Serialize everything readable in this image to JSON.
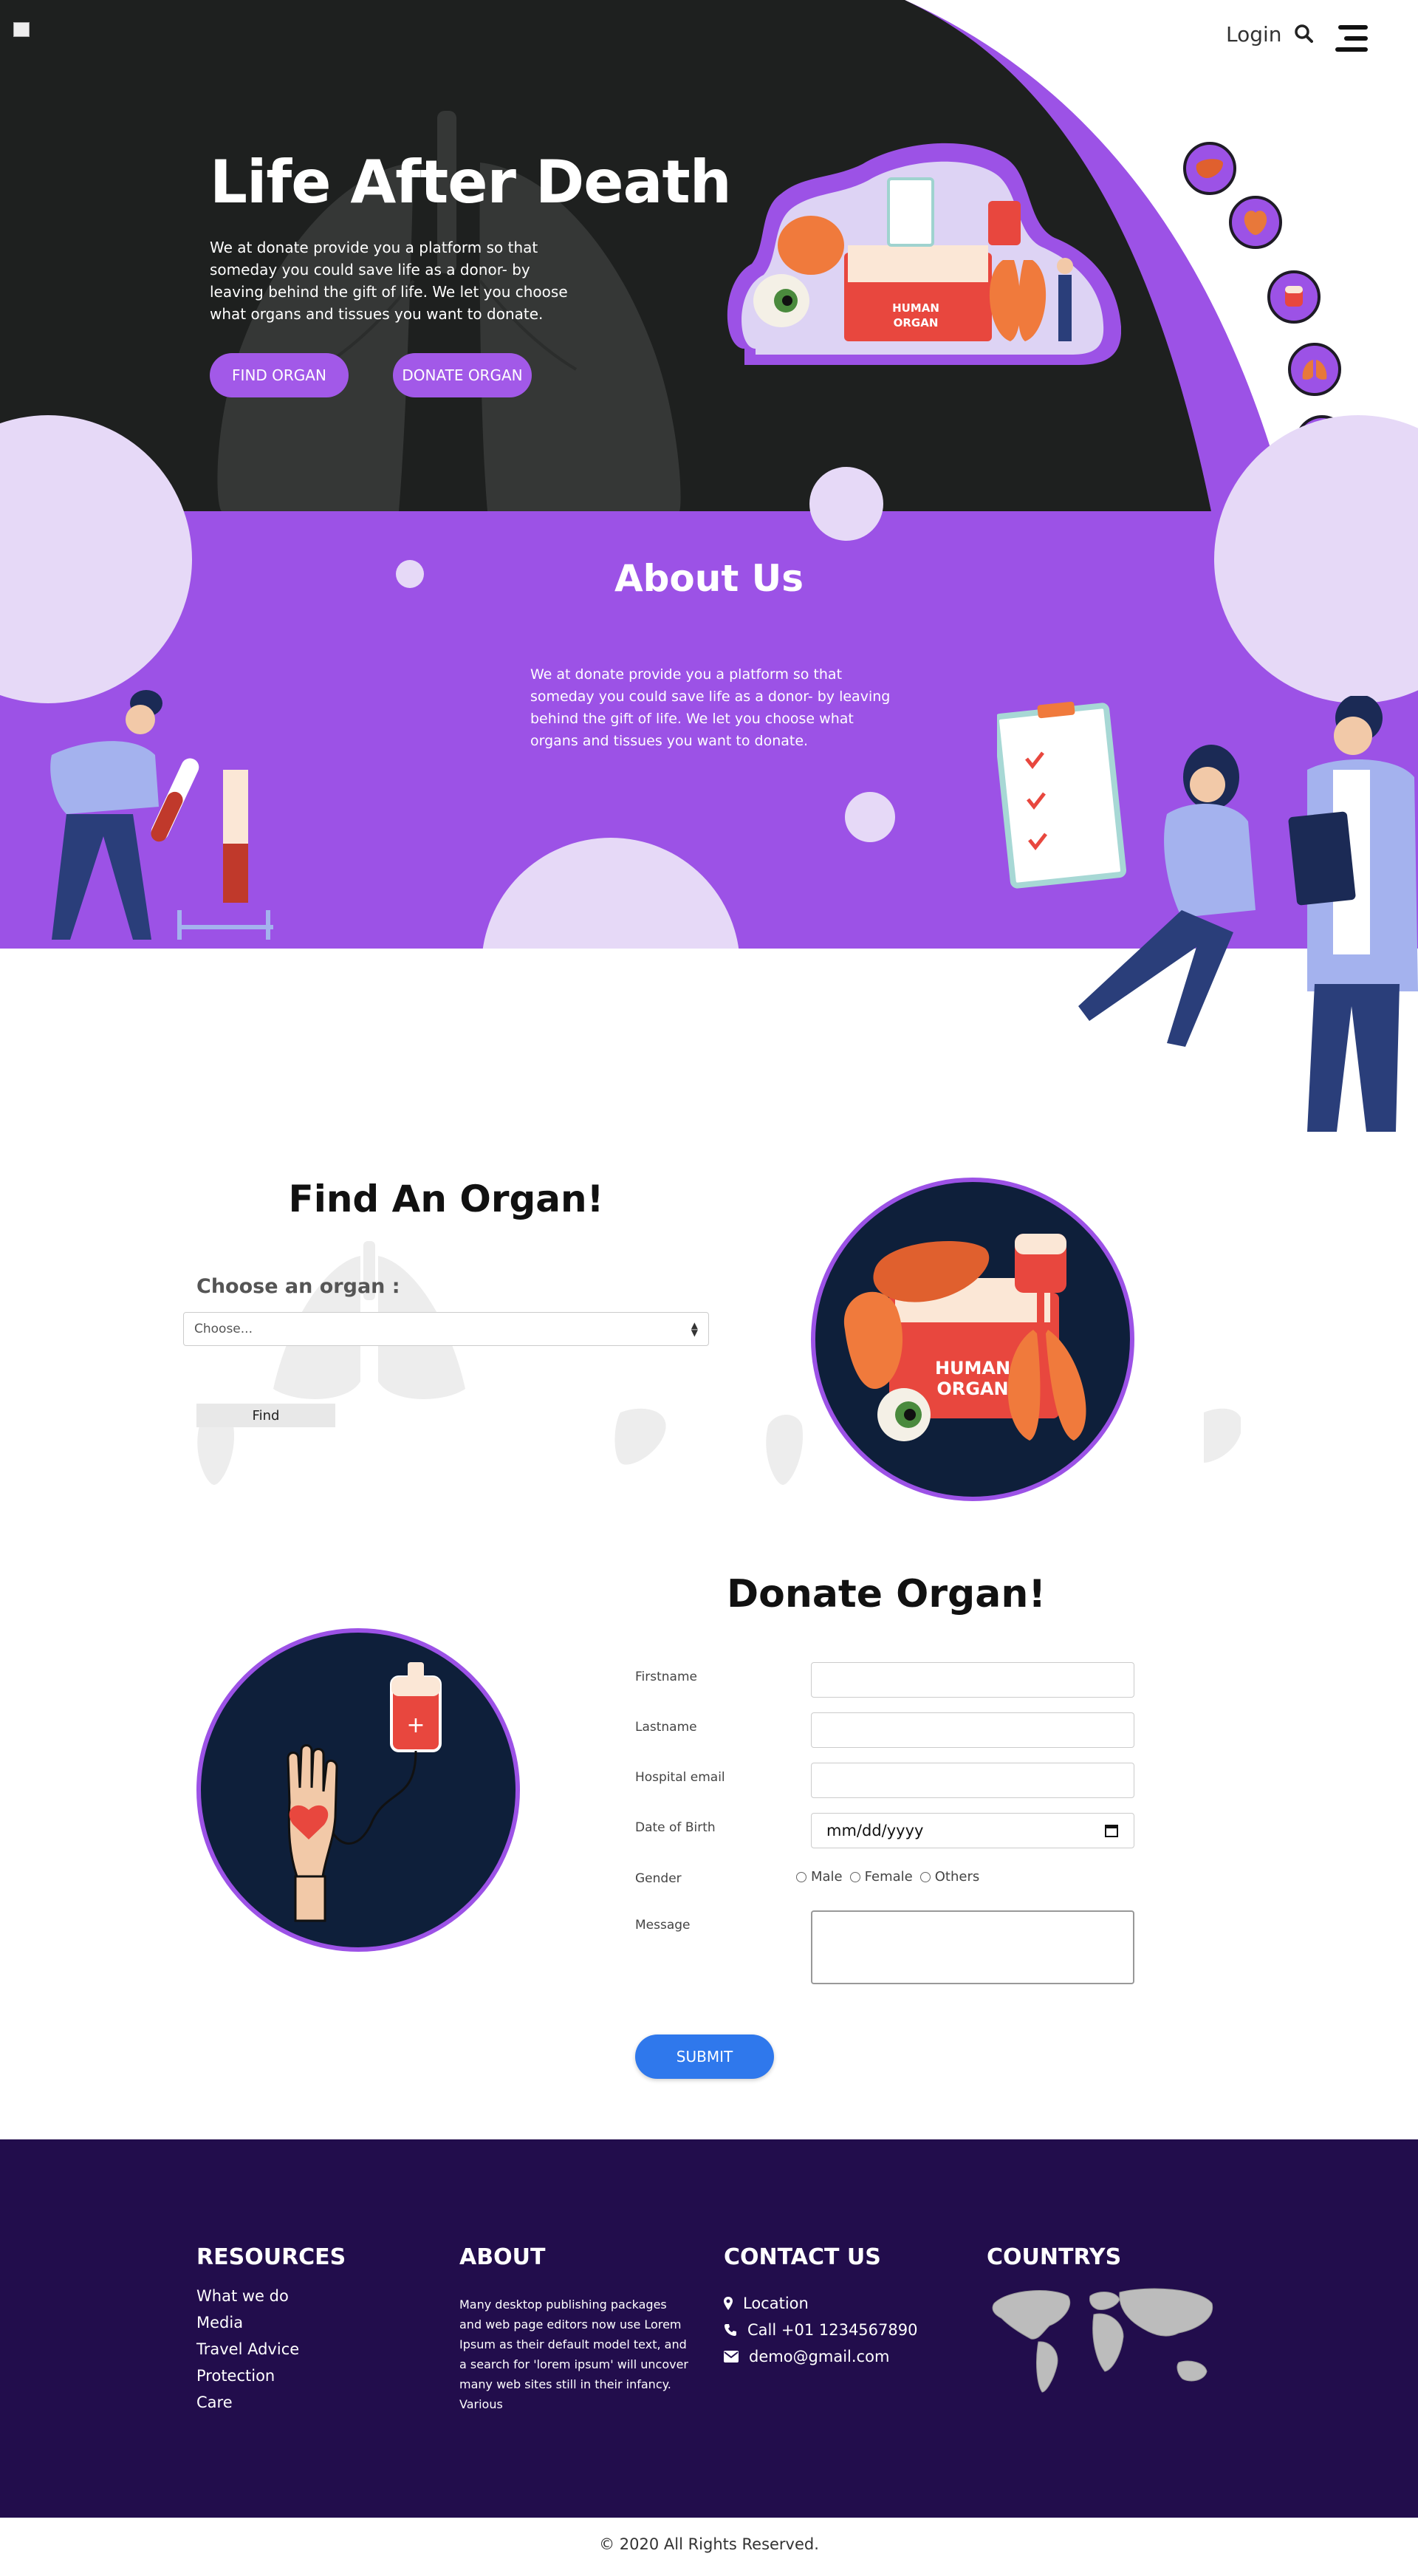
{
  "nav": {
    "login_label": "Login"
  },
  "hero": {
    "title": "Life After Death",
    "text": "We at donate provide you a platform so that someday you could save life as a donor- by leaving behind the gift of life. We let you choose what organs and tissues you want to donate.",
    "find_button": "FIND ORGAN",
    "donate_button": "DONATE ORGAN",
    "illustration_text": "HUMAN\nORGAN"
  },
  "about": {
    "title": "About Us",
    "text": "We at donate provide you a platform so that someday you could save life as a donor- by leaving behind the gift of life. We let you choose what organs and tissues you want to donate."
  },
  "find": {
    "title": "Find An Organ!",
    "label": "Choose an organ :",
    "select_value": "Choose...",
    "button": "Find",
    "circle_text": "HUMAN\nORGAN"
  },
  "donate": {
    "title": "Donate Organ!",
    "firstname_label": "Firstname",
    "lastname_label": "Lastname",
    "email_label": "Hospital email",
    "dob_label": "Date of Birth",
    "dob_placeholder": "mm/dd/yyyy",
    "gender_label": "Gender",
    "gender_options": [
      "Male",
      "Female",
      "Others"
    ],
    "message_label": "Message",
    "submit": "SUBMIT"
  },
  "footer": {
    "resources_title": "RESOURCES",
    "resources": [
      "What we do",
      "Media",
      "Travel Advice",
      "Protection",
      "Care"
    ],
    "about_title": "ABOUT",
    "about_text": "Many desktop publishing packages and web page editors now use Lorem Ipsum as their default model text, and a search for 'lorem ipsum' will uncover many web sites still in their infancy. Various",
    "contact_title": "CONTACT US",
    "contact_location": "Location",
    "contact_phone": "Call +01 1234567890",
    "contact_email": "demo@gmail.com",
    "countries_title": "COUNTRYS",
    "copyright": "© 2020 All Rights Reserved."
  },
  "colors": {
    "accent": "#9c52e6",
    "dark": "#1e1f1f",
    "footer": "#220d4c",
    "submit": "#2f78ec"
  },
  "icons": [
    "search-icon",
    "menu-icon",
    "liver-icon",
    "heart-icon",
    "blood-bag-icon",
    "lungs-icon",
    "eye-icon",
    "location-icon",
    "phone-icon",
    "mail-icon"
  ]
}
